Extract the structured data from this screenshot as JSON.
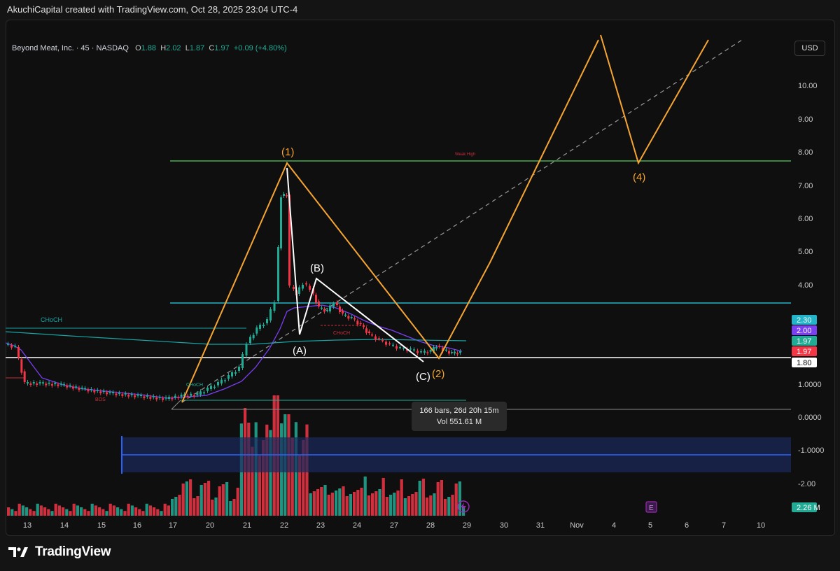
{
  "attribution": "AkuchiCapital created with TradingView.com, Oct 28, 2025 23:04 UTC-4",
  "legend": {
    "symbol": "Beyond Meat, Inc. · 45 · NASDAQ",
    "o_label": "O",
    "o": "1.88",
    "h_label": "H",
    "h": "2.02",
    "l_label": "L",
    "l": "1.87",
    "c_label": "C",
    "c": "1.97",
    "change": "+0.09 (+4.80%)"
  },
  "currency": "USD",
  "price_axis": {
    "ticks": [
      "10.00",
      "9.00",
      "8.00",
      "7.00",
      "6.00",
      "5.00",
      "4.00",
      "1.0000",
      "0.0000",
      "-1.0000",
      "-2.00"
    ],
    "tags": [
      {
        "text": "2.30",
        "bg": "#22b5c9",
        "fg": "#ffffff"
      },
      {
        "text": "2.00",
        "bg": "#7b3ff2",
        "fg": "#ffffff"
      },
      {
        "text": "1.97",
        "bg": "#22ab94",
        "fg": "#ffffff"
      },
      {
        "text": "1.97",
        "bg": "#f23645",
        "fg": "#ffffff"
      },
      {
        "text": "1.80",
        "bg": "#ffffff",
        "fg": "#000000"
      },
      {
        "text": "2.26 M",
        "bg": "#22ab94",
        "fg": "#ffffff"
      }
    ]
  },
  "time_axis": [
    "13",
    "14",
    "15",
    "16",
    "17",
    "20",
    "21",
    "22",
    "23",
    "24",
    "27",
    "28",
    "29",
    "30",
    "31",
    "Nov",
    "4",
    "5",
    "6",
    "7",
    "10"
  ],
  "wave_labels": {
    "w1": "(1)",
    "w2": "(2)",
    "w4": "(4)",
    "a": "(A)",
    "b": "(B)",
    "c": "(C)"
  },
  "annotations": {
    "weak_high": "Weak High",
    "choch_1": "CHoCH",
    "choch_2": "CHoCH",
    "choch_3": "CHoCH",
    "bos": "BOS"
  },
  "tooltip": {
    "line1": "166 bars, 26d 20h 15m",
    "line2": "Vol 551.61 M"
  },
  "colors": {
    "up": "#22ab94",
    "down": "#f23645",
    "wave": "#f7a531",
    "abc": "#ffffff",
    "resistance_green": "#4caf50",
    "resistance_cyan": "#22b5c9",
    "ma": "#7b3ff2",
    "box": "#2962ff"
  },
  "icons": {
    "dividend_marker": "lightning-icon",
    "earnings_marker": "earnings-e-icon",
    "logo": "tradingview-logo-icon"
  },
  "brand": "TradingView",
  "earnings_letter": "E"
}
